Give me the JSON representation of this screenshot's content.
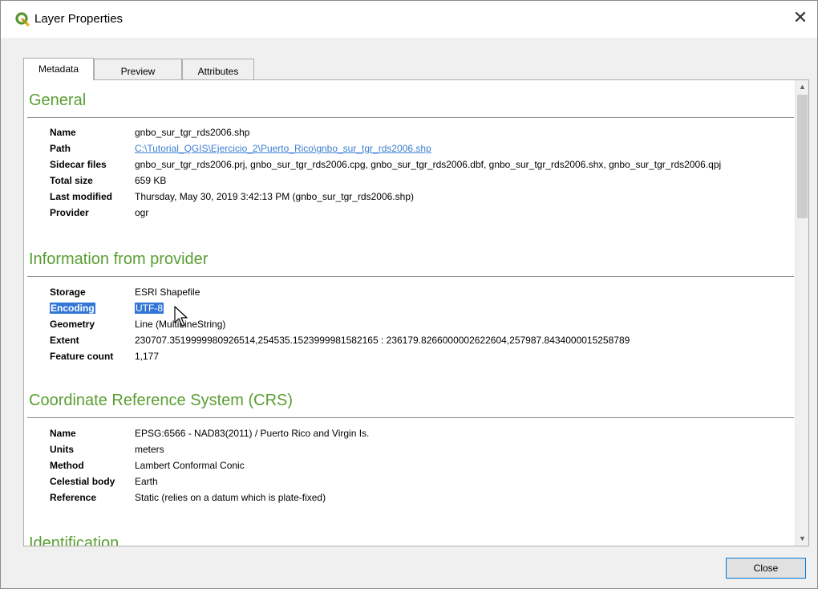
{
  "window": {
    "title": "Layer Properties",
    "close_glyph": "✕"
  },
  "icons": {
    "app": "qgis-icon",
    "close": "close-icon",
    "scroll_up": "scroll-up-icon",
    "scroll_down": "scroll-down-icon",
    "cursor": "mouse-cursor-icon"
  },
  "colors": {
    "section_title": "#5a9e32",
    "link": "#3b7fd0",
    "selection": "#3377d6",
    "button_border": "#0078d7"
  },
  "tabs": [
    {
      "label": "Metadata",
      "active": true
    },
    {
      "label": "Preview",
      "active": false
    },
    {
      "label": "Attributes",
      "active": false
    }
  ],
  "general": {
    "title": "General",
    "rows": [
      {
        "key": "Name",
        "value": "gnbo_sur_tgr_rds2006.shp"
      },
      {
        "key": "Path",
        "value": "C:\\Tutorial_QGIS\\Ejercicio_2\\Puerto_Rico\\gnbo_sur_tgr_rds2006.shp"
      },
      {
        "key": "Sidecar files",
        "value": "gnbo_sur_tgr_rds2006.prj, gnbo_sur_tgr_rds2006.cpg, gnbo_sur_tgr_rds2006.dbf, gnbo_sur_tgr_rds2006.shx, gnbo_sur_tgr_rds2006.qpj"
      },
      {
        "key": "Total size",
        "value": "659 KB"
      },
      {
        "key": "Last modified",
        "value": "Thursday, May 30, 2019 3:42:13 PM (gnbo_sur_tgr_rds2006.shp)"
      },
      {
        "key": "Provider",
        "value": "ogr"
      }
    ]
  },
  "provider": {
    "title": "Information from provider",
    "rows": [
      {
        "key": "Storage",
        "value": "ESRI Shapefile"
      },
      {
        "key": "Encoding",
        "value": "UTF-8"
      },
      {
        "key": "Geometry",
        "value": "Line (MultiLineString)"
      },
      {
        "key": "Extent",
        "value": "230707.3519999980926514,254535.1523999981582165 : 236179.8266000002622604,257987.8434000015258789"
      },
      {
        "key": "Feature count",
        "value": "1,177"
      }
    ]
  },
  "crs": {
    "title": "Coordinate Reference System (CRS)",
    "rows": [
      {
        "key": "Name",
        "value": "EPSG:6566 - NAD83(2011) / Puerto Rico and Virgin Is."
      },
      {
        "key": "Units",
        "value": "meters"
      },
      {
        "key": "Method",
        "value": "Lambert Conformal Conic"
      },
      {
        "key": "Celestial body",
        "value": "Earth"
      },
      {
        "key": "Reference",
        "value": "Static (relies on a datum which is plate-fixed)"
      }
    ]
  },
  "identification": {
    "title": "Identification"
  },
  "buttons": {
    "close": "Close"
  }
}
